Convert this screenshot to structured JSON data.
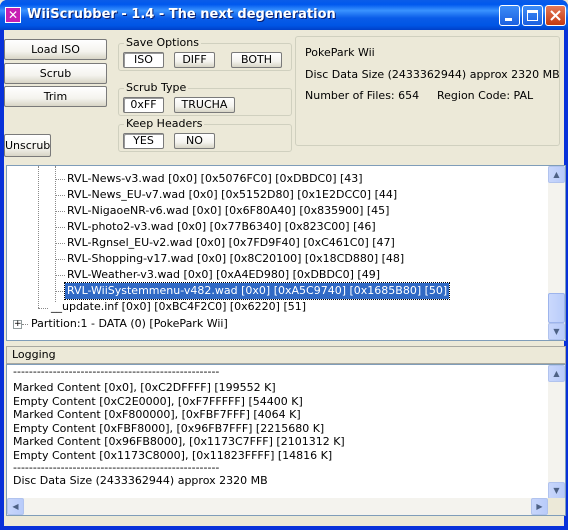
{
  "window": {
    "title": "WiiScrubber - 1.4 - The next degeneration"
  },
  "buttons": {
    "load_iso": "Load ISO",
    "scrub": "Scrub",
    "trim": "Trim",
    "unscrub": "Unscrub"
  },
  "save_options": {
    "label": "Save Options",
    "iso": "ISO",
    "diff": "DIFF",
    "both": "BOTH",
    "selected": "ISO"
  },
  "scrub_type": {
    "label": "Scrub Type",
    "xff": "0xFF",
    "trucha": "TRUCHA",
    "selected": "0xFF"
  },
  "keep_headers": {
    "label": "Keep Headers",
    "yes": "YES",
    "no": "NO",
    "selected": "YES"
  },
  "info": {
    "game_name": "PokePark Wii",
    "disc_data_size": "Disc Data Size (2433362944) approx  2320 MB",
    "num_files": "Number of Files: 654",
    "region_code": "Region Code: PAL"
  },
  "tree": {
    "items": [
      {
        "label": "RVL-News-v3.wad [0x0] [0x5076FC0] [0xDBDC0] [43]"
      },
      {
        "label": "RVL-News_EU-v7.wad [0x0] [0x5152D80] [0x1E2DCC0] [44]"
      },
      {
        "label": "RVL-NigaoeNR-v6.wad [0x0] [0x6F80A40] [0x835900] [45]"
      },
      {
        "label": "RVL-photo2-v3.wad [0x0] [0x77B6340] [0x823C00] [46]"
      },
      {
        "label": "RVL-Rgnsel_EU-v2.wad [0x0] [0x7FD9F40] [0xC461C0] [47]"
      },
      {
        "label": "RVL-Shopping-v17.wad [0x0] [0x8C20100] [0x18CD880] [48]"
      },
      {
        "label": "RVL-Weather-v3.wad [0x0] [0xA4ED980] [0xDBDC0] [49]"
      },
      {
        "label": "RVL-WiiSystemmenu-v482.wad [0x0] [0xA5C9740] [0x1685B80] [50]"
      }
    ],
    "update_item": "__update.inf [0x0] [0xBC4F2C0] [0x6220] [51]",
    "partition_item": "Partition:1 - DATA (0) [PokePark Wii]",
    "selected_index": 7
  },
  "logging": {
    "label": "Logging",
    "separator": "----------------------------------------------------",
    "lines": [
      "Marked Content [0x0], [0xC2DFFFF] [199552 K]",
      "Empty Content [0xC2E0000], [0xF7FFFFF] [54400 K]",
      "Marked Content [0xF800000], [0xFBF7FFF] [4064 K]",
      "Empty Content [0xFBF8000], [0x96FB7FFF] [2215680 K]",
      "Marked Content [0x96FB8000], [0x1173C7FFF] [2101312 K]",
      "Empty Content [0x1173C8000], [0x11823FFFF] [14816 K]"
    ],
    "footer": "Disc Data Size (2433362944) approx  2320 MB"
  },
  "colors": {
    "selection": "#316ac5",
    "titlebar": "#0a5ce8",
    "window_bg": "#ece9d8"
  }
}
